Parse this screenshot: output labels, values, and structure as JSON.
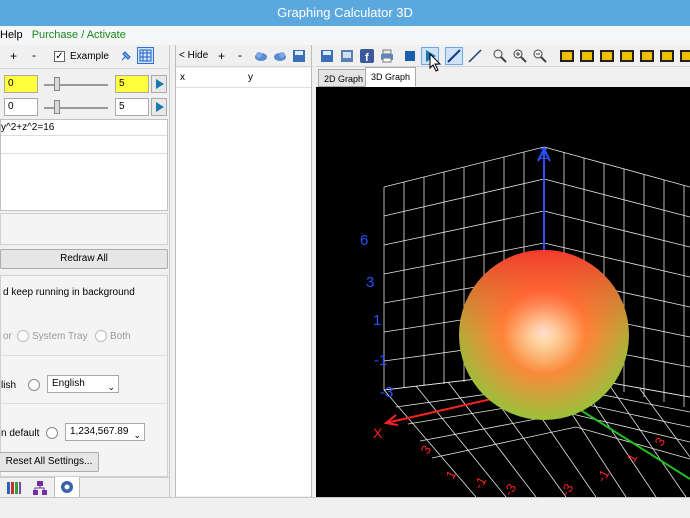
{
  "window": {
    "title": "Graphing Calculator 3D"
  },
  "menu": {
    "help": "Help",
    "purchase": "Purchase / Activate"
  },
  "left": {
    "toolbar": {
      "plus": "+",
      "minus": "-",
      "example_label": "Example",
      "example_checked": true
    },
    "row1": {
      "from": "0",
      "to": "5"
    },
    "row2": {
      "from": "0",
      "to": "5"
    },
    "equation": "y^2+z^2=16",
    "redraw_label": "Redraw All",
    "keep_running_label": "d keep running in background",
    "tray": {
      "prefix": "or",
      "system_tray": "System Tray",
      "both": "Both"
    },
    "language": {
      "prefix": "lish",
      "selected": "English"
    },
    "number_format": {
      "prefix": "n default",
      "selected": "1,234,567.89"
    },
    "reset_label": "Reset All Settings..."
  },
  "middle": {
    "hide_label": "< Hide",
    "plus": "+",
    "minus": "-",
    "columns": [
      "x",
      "y"
    ]
  },
  "right": {
    "tabs": [
      "2D Graph",
      "3D Graph"
    ],
    "active_tab": "3D Graph"
  },
  "graph": {
    "axis_labels": {
      "z": "Z",
      "x": "X"
    },
    "z_ticks": [
      "6",
      "3",
      "1",
      "-1",
      "-3"
    ],
    "x_ticks": [
      "3",
      "1",
      "-1",
      "-3"
    ],
    "y_ticks": [
      "-3",
      "-1",
      "1",
      "3"
    ],
    "colors": {
      "background": "#000000",
      "z_axis": "#2a50ff",
      "x_axis": "#ff2020",
      "y_axis": "#20c020",
      "grid": "#e8e8e8"
    }
  }
}
